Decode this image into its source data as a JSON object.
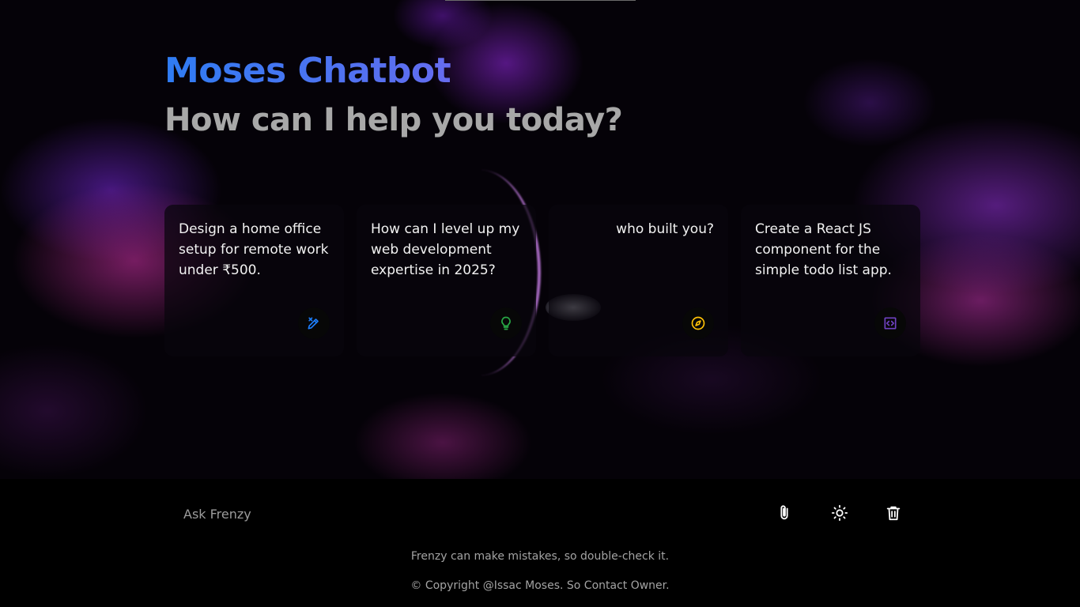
{
  "header": {
    "title": "Moses Chatbot",
    "subtitle": "How can I help you today?"
  },
  "suggestions": [
    {
      "text": "Design a home office setup for remote work under ₹500.",
      "icon": "draw-icon",
      "icon_color": "#1d7efd"
    },
    {
      "text": "How can I level up my web development expertise in 2025?",
      "icon": "lightbulb-icon",
      "icon_color": "#28a745"
    },
    {
      "text": "who built you?",
      "icon": "explore-icon",
      "icon_color": "#ffc107"
    },
    {
      "text": "Create a React JS component for the simple todo list app.",
      "icon": "code-icon",
      "icon_color": "#6f42c1"
    }
  ],
  "prompt": {
    "placeholder": "Ask Frenzy",
    "actions": [
      "attach-icon",
      "theme-toggle-icon",
      "delete-icon"
    ]
  },
  "footer": {
    "disclaimer": "Frenzy can make mistakes, so double-check it.",
    "copyright": "© Copyright @Issac Moses. So Contact Owner."
  },
  "colors": {
    "title_gradient_start": "#2f7cf3",
    "title_gradient_end": "#9b63e8",
    "subtitle": "#a8a8a8",
    "background": "#000000"
  }
}
